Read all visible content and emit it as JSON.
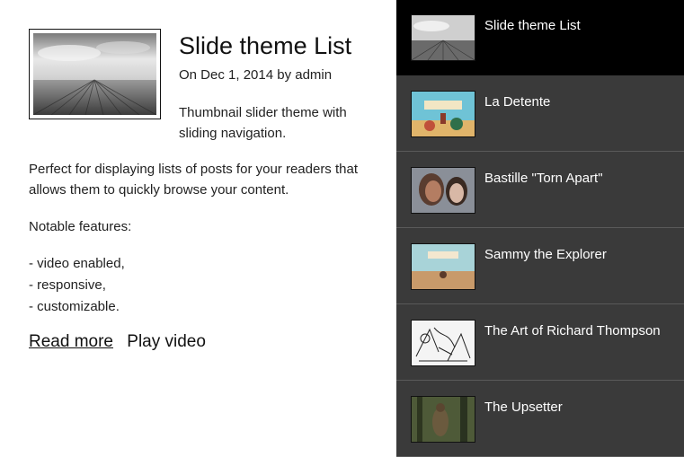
{
  "post": {
    "title": "Slide theme List",
    "meta": "On Dec 1, 2014 by admin",
    "excerpt": "Thumbnail slider theme with sliding navigation.",
    "paragraph1": "Perfect for displaying lists of posts for your readers that allows them to quickly browse your content.",
    "paragraph2": "Notable features:",
    "features": [
      "- video enabled,",
      "- responsive,",
      "- customizable."
    ],
    "read_more": "Read more",
    "play_video": "Play video"
  },
  "sidebar": {
    "items": [
      {
        "label": "Slide theme List",
        "active": true,
        "thumb": "boardwalk-sky"
      },
      {
        "label": "La Detente",
        "active": false,
        "thumb": "la-detente-poster"
      },
      {
        "label": "Bastille \"Torn Apart\"",
        "active": false,
        "thumb": "couple-portrait"
      },
      {
        "label": "Sammy the Explorer",
        "active": false,
        "thumb": "sammy-poster"
      },
      {
        "label": "The Art of Richard Thompson",
        "active": false,
        "thumb": "sketch-drawing"
      },
      {
        "label": "The Upsetter",
        "active": false,
        "thumb": "forest-figure"
      }
    ]
  },
  "colors": {
    "sidebar_bg": "#3a3a3a",
    "active_item_bg": "#000000",
    "divider": "#5a5a5a"
  }
}
